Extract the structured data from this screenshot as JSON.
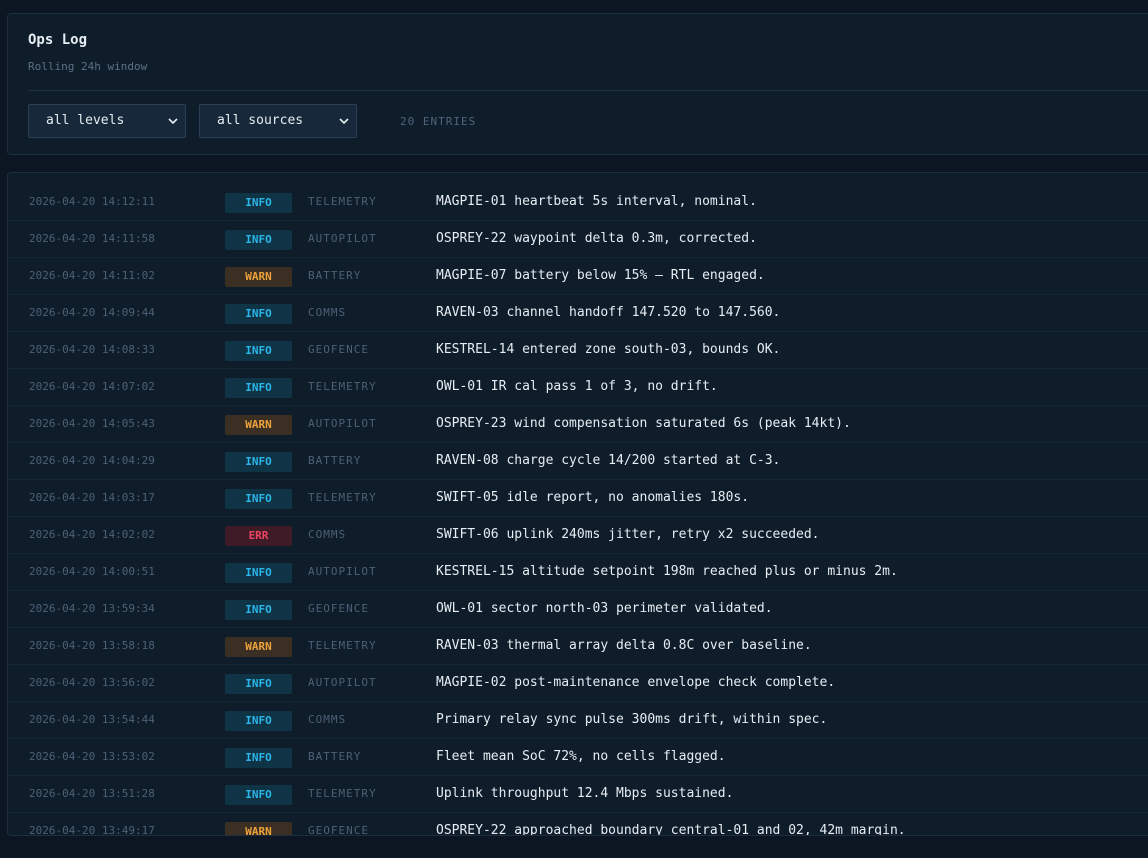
{
  "header": {
    "title": "Ops Log",
    "subtitle": "Rolling 24h window",
    "level_filter": "all levels",
    "source_filter": "all sources",
    "entries_count": "20 ENTRIES"
  },
  "colors": {
    "info": "#2bb5e8",
    "warn": "#eda23c",
    "err": "#ef4462"
  },
  "log": [
    {
      "ts": "2026-04-20 14:12:11",
      "level": "INFO",
      "source": "TELEMETRY",
      "message": "MAGPIE-01 heartbeat 5s interval, nominal."
    },
    {
      "ts": "2026-04-20 14:11:58",
      "level": "INFO",
      "source": "AUTOPILOT",
      "message": "OSPREY-22 waypoint delta 0.3m, corrected."
    },
    {
      "ts": "2026-04-20 14:11:02",
      "level": "WARN",
      "source": "BATTERY",
      "message": "MAGPIE-07 battery below 15% — RTL engaged."
    },
    {
      "ts": "2026-04-20 14:09:44",
      "level": "INFO",
      "source": "COMMS",
      "message": "RAVEN-03 channel handoff 147.520 to 147.560."
    },
    {
      "ts": "2026-04-20 14:08:33",
      "level": "INFO",
      "source": "GEOFENCE",
      "message": "KESTREL-14 entered zone south-03, bounds OK."
    },
    {
      "ts": "2026-04-20 14:07:02",
      "level": "INFO",
      "source": "TELEMETRY",
      "message": "OWL-01 IR cal pass 1 of 3, no drift."
    },
    {
      "ts": "2026-04-20 14:05:43",
      "level": "WARN",
      "source": "AUTOPILOT",
      "message": "OSPREY-23 wind compensation saturated 6s (peak 14kt)."
    },
    {
      "ts": "2026-04-20 14:04:29",
      "level": "INFO",
      "source": "BATTERY",
      "message": "RAVEN-08 charge cycle 14/200 started at C-3."
    },
    {
      "ts": "2026-04-20 14:03:17",
      "level": "INFO",
      "source": "TELEMETRY",
      "message": "SWIFT-05 idle report, no anomalies 180s."
    },
    {
      "ts": "2026-04-20 14:02:02",
      "level": "ERR",
      "source": "COMMS",
      "message": "SWIFT-06 uplink 240ms jitter, retry x2 succeeded."
    },
    {
      "ts": "2026-04-20 14:00:51",
      "level": "INFO",
      "source": "AUTOPILOT",
      "message": "KESTREL-15 altitude setpoint 198m reached plus or minus 2m."
    },
    {
      "ts": "2026-04-20 13:59:34",
      "level": "INFO",
      "source": "GEOFENCE",
      "message": "OWL-01 sector north-03 perimeter validated."
    },
    {
      "ts": "2026-04-20 13:58:18",
      "level": "WARN",
      "source": "TELEMETRY",
      "message": "RAVEN-03 thermal array delta 0.8C over baseline."
    },
    {
      "ts": "2026-04-20 13:56:02",
      "level": "INFO",
      "source": "AUTOPILOT",
      "message": "MAGPIE-02 post-maintenance envelope check complete."
    },
    {
      "ts": "2026-04-20 13:54:44",
      "level": "INFO",
      "source": "COMMS",
      "message": "Primary relay sync pulse 300ms drift, within spec."
    },
    {
      "ts": "2026-04-20 13:53:02",
      "level": "INFO",
      "source": "BATTERY",
      "message": "Fleet mean SoC 72%, no cells flagged."
    },
    {
      "ts": "2026-04-20 13:51:28",
      "level": "INFO",
      "source": "TELEMETRY",
      "message": "Uplink throughput 12.4 Mbps sustained."
    },
    {
      "ts": "2026-04-20 13:49:17",
      "level": "WARN",
      "source": "GEOFENCE",
      "message": "OSPREY-22 approached boundary central-01 and 02, 42m margin."
    }
  ]
}
